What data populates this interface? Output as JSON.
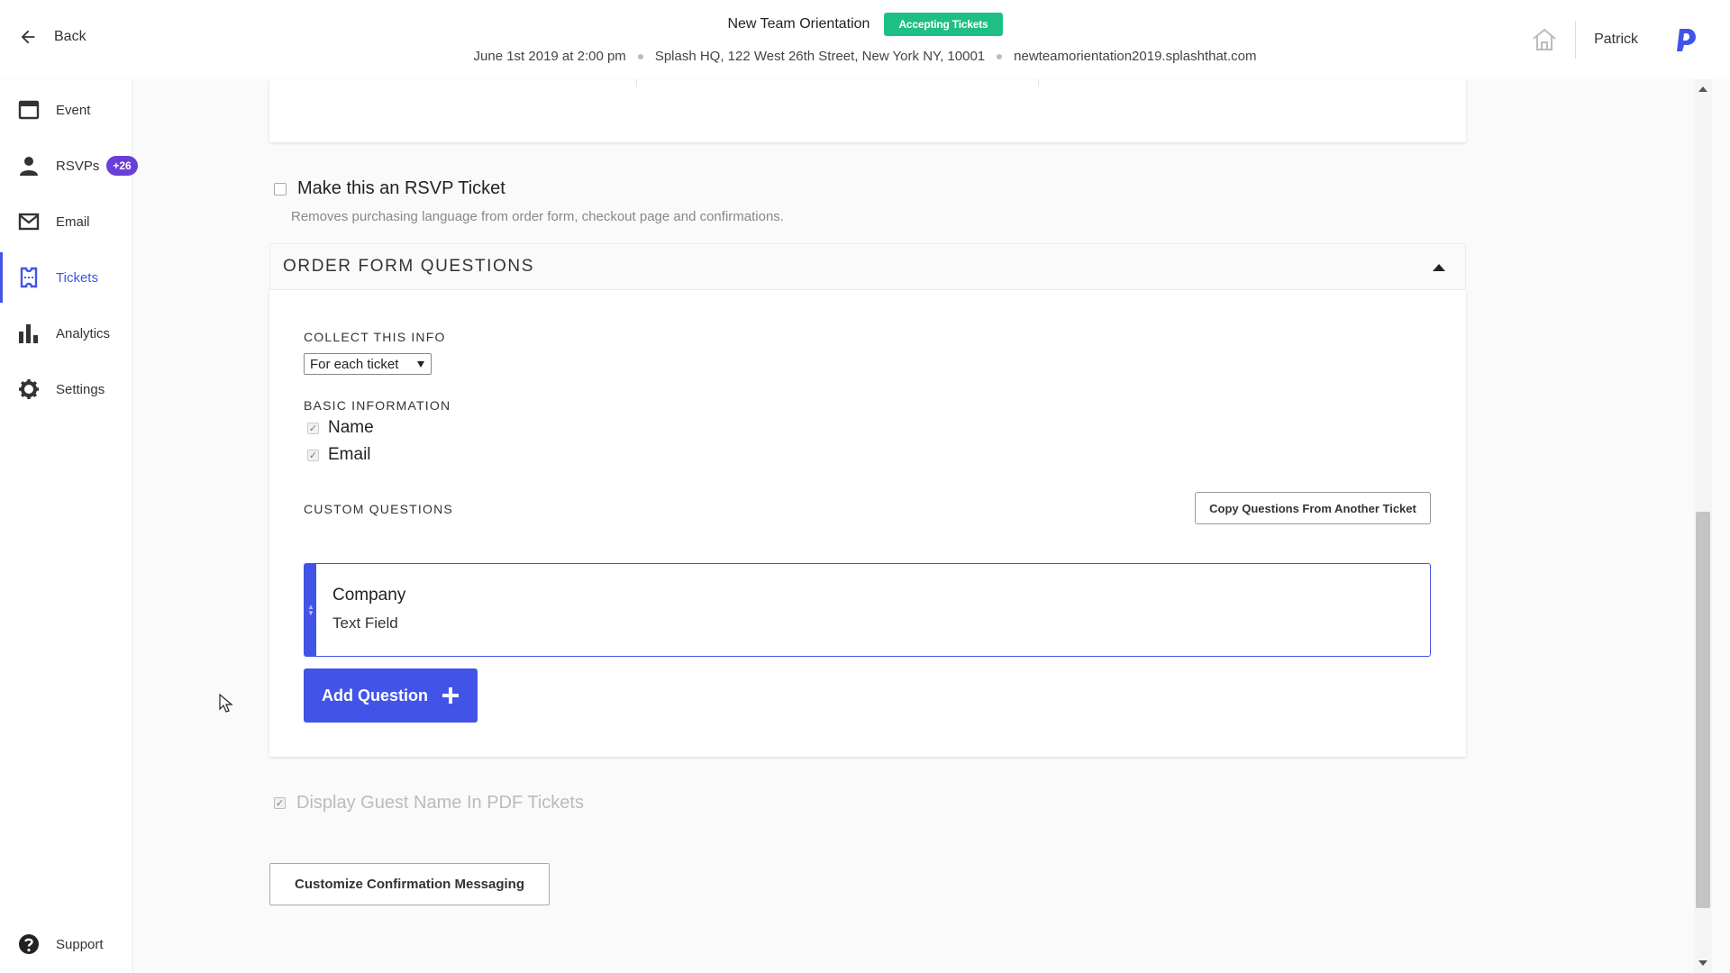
{
  "header": {
    "back_label": "Back",
    "event_title": "New Team Orientation",
    "status": "Accepting Tickets",
    "date": "June 1st 2019 at 2:00 pm",
    "location": "Splash HQ, 122 West 26th Street, New York NY, 10001",
    "url": "newteamorientation2019.splashthat.com",
    "user_name": "Patrick"
  },
  "sidebar": {
    "items": [
      {
        "label": "Event",
        "icon": "calendar-icon"
      },
      {
        "label": "RSVPs",
        "icon": "person-icon",
        "badge": "+26"
      },
      {
        "label": "Email",
        "icon": "envelope-icon"
      },
      {
        "label": "Tickets",
        "icon": "ticket-icon",
        "active": true
      },
      {
        "label": "Analytics",
        "icon": "bar-chart-icon"
      },
      {
        "label": "Settings",
        "icon": "gear-icon"
      }
    ],
    "support_label": "Support"
  },
  "main": {
    "rsvp_ticket_label": "Make this an RSVP Ticket",
    "rsvp_ticket_help": "Removes purchasing language from order form, checkout page and confirmations.",
    "order_form": {
      "title": "ORDER FORM QUESTIONS",
      "collect_label": "COLLECT THIS INFO",
      "collect_value": "For each ticket",
      "basic_label": "BASIC INFORMATION",
      "basic_fields": [
        "Name",
        "Email"
      ],
      "custom_label": "CUSTOM QUESTIONS",
      "copy_button": "Copy Questions From Another Ticket",
      "questions": [
        {
          "title": "Company",
          "type": "Text Field"
        }
      ],
      "add_button": "Add Question"
    },
    "display_guest_label": "Display Guest Name In PDF Tickets",
    "confirm_button": "Customize Confirmation Messaging"
  },
  "colors": {
    "accent": "#4254e8",
    "status_green": "#1dbf85",
    "badge_purple": "#6a3fd8"
  }
}
